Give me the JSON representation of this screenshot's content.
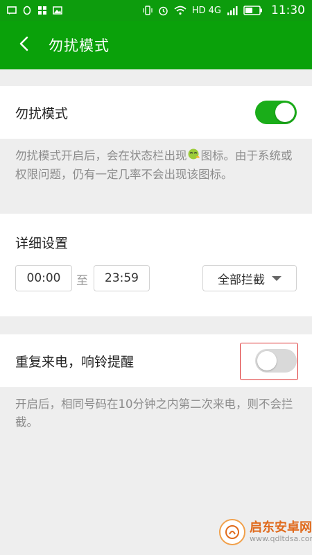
{
  "status_bar": {
    "network": "HD 4G",
    "time": "11:30"
  },
  "app_bar": {
    "title": "勿扰模式"
  },
  "dnd": {
    "label": "勿扰模式",
    "enabled": true,
    "description_part1": "勿扰模式开启后，会在状态栏出现",
    "description_part2": "图标。由于系统或权限问题，仍有一定几率不会出现该图标。"
  },
  "detail": {
    "title": "详细设置",
    "start_time": "00:00",
    "to_label": "至",
    "end_time": "23:59",
    "block_mode": "全部拦截"
  },
  "repeat_call": {
    "label": "重复来电，响铃提醒",
    "enabled": false,
    "description": "开启后，相同号码在10分钟之内第二次来电，则不会拦截。"
  },
  "watermark": {
    "title": "启东安卓网",
    "url": "www.qdltdsa.com"
  },
  "colors": {
    "status_bar": "#0d9c0d",
    "app_bar": "#0aa10a",
    "toggle_on": "#1aad19",
    "toggle_off": "#d9d9d9",
    "highlight": "#dd3333"
  }
}
